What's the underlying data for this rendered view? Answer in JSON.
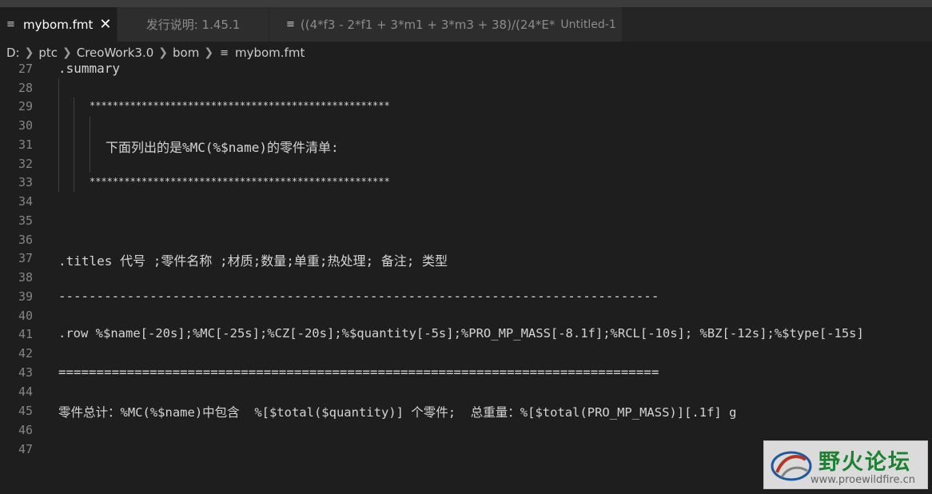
{
  "tabs": [
    {
      "icon": "lines-file-icon",
      "label": "mybom.fmt",
      "active": true,
      "close": "✕"
    },
    {
      "label": "发行说明: 1.45.1"
    },
    {
      "icon": "lines-file-icon",
      "label": "((4*f3 - 2*f1 + 3*m1 + 3*m3 + 38)/(24*E*",
      "suffix": "Untitled-1"
    }
  ],
  "breadcrumb": [
    "D:",
    "ptc",
    "CreoWork3.0",
    "bom",
    "mybom.fmt"
  ],
  "lines": [
    {
      "n": "27",
      "text": ".summary"
    },
    {
      "n": "28",
      "text": ""
    },
    {
      "n": "29",
      "text": "****************************************************"
    },
    {
      "n": "30",
      "text": ""
    },
    {
      "n": "31",
      "text": "下面列出的是%MC(%$name)的零件清单:"
    },
    {
      "n": "32",
      "text": ""
    },
    {
      "n": "33",
      "text": "****************************************************"
    },
    {
      "n": "34",
      "text": ""
    },
    {
      "n": "35",
      "text": ""
    },
    {
      "n": "36",
      "text": ""
    },
    {
      "n": "37",
      "text": ".titles 代号 ;零件名称 ;材质;数量;单重;热处理; 备注; 类型"
    },
    {
      "n": "38",
      "text": ""
    },
    {
      "n": "39",
      "text": "-------------------------------------------------------------------------------"
    },
    {
      "n": "40",
      "text": ""
    },
    {
      "n": "41",
      "text": ".row %$name[-20s];%MC[-25s];%CZ[-20s];%$quantity[-5s];%PRO_MP_MASS[-8.1f];%RCL[-10s]; %BZ[-12s];%$type[-15s]"
    },
    {
      "n": "42",
      "text": ""
    },
    {
      "n": "43",
      "text": "==============================================================================="
    },
    {
      "n": "44",
      "text": ""
    },
    {
      "n": "45",
      "text": "零件总计：%MC(%$name)中包含  %[$total($quantity)] 个零件;  总重量：%[$total(PRO_MP_MASS)][.1f] g"
    },
    {
      "n": "46",
      "text": ""
    },
    {
      "n": "47",
      "text": ""
    }
  ],
  "watermark": {
    "title": "野火论坛",
    "url": "www.proewildfire.cn"
  }
}
